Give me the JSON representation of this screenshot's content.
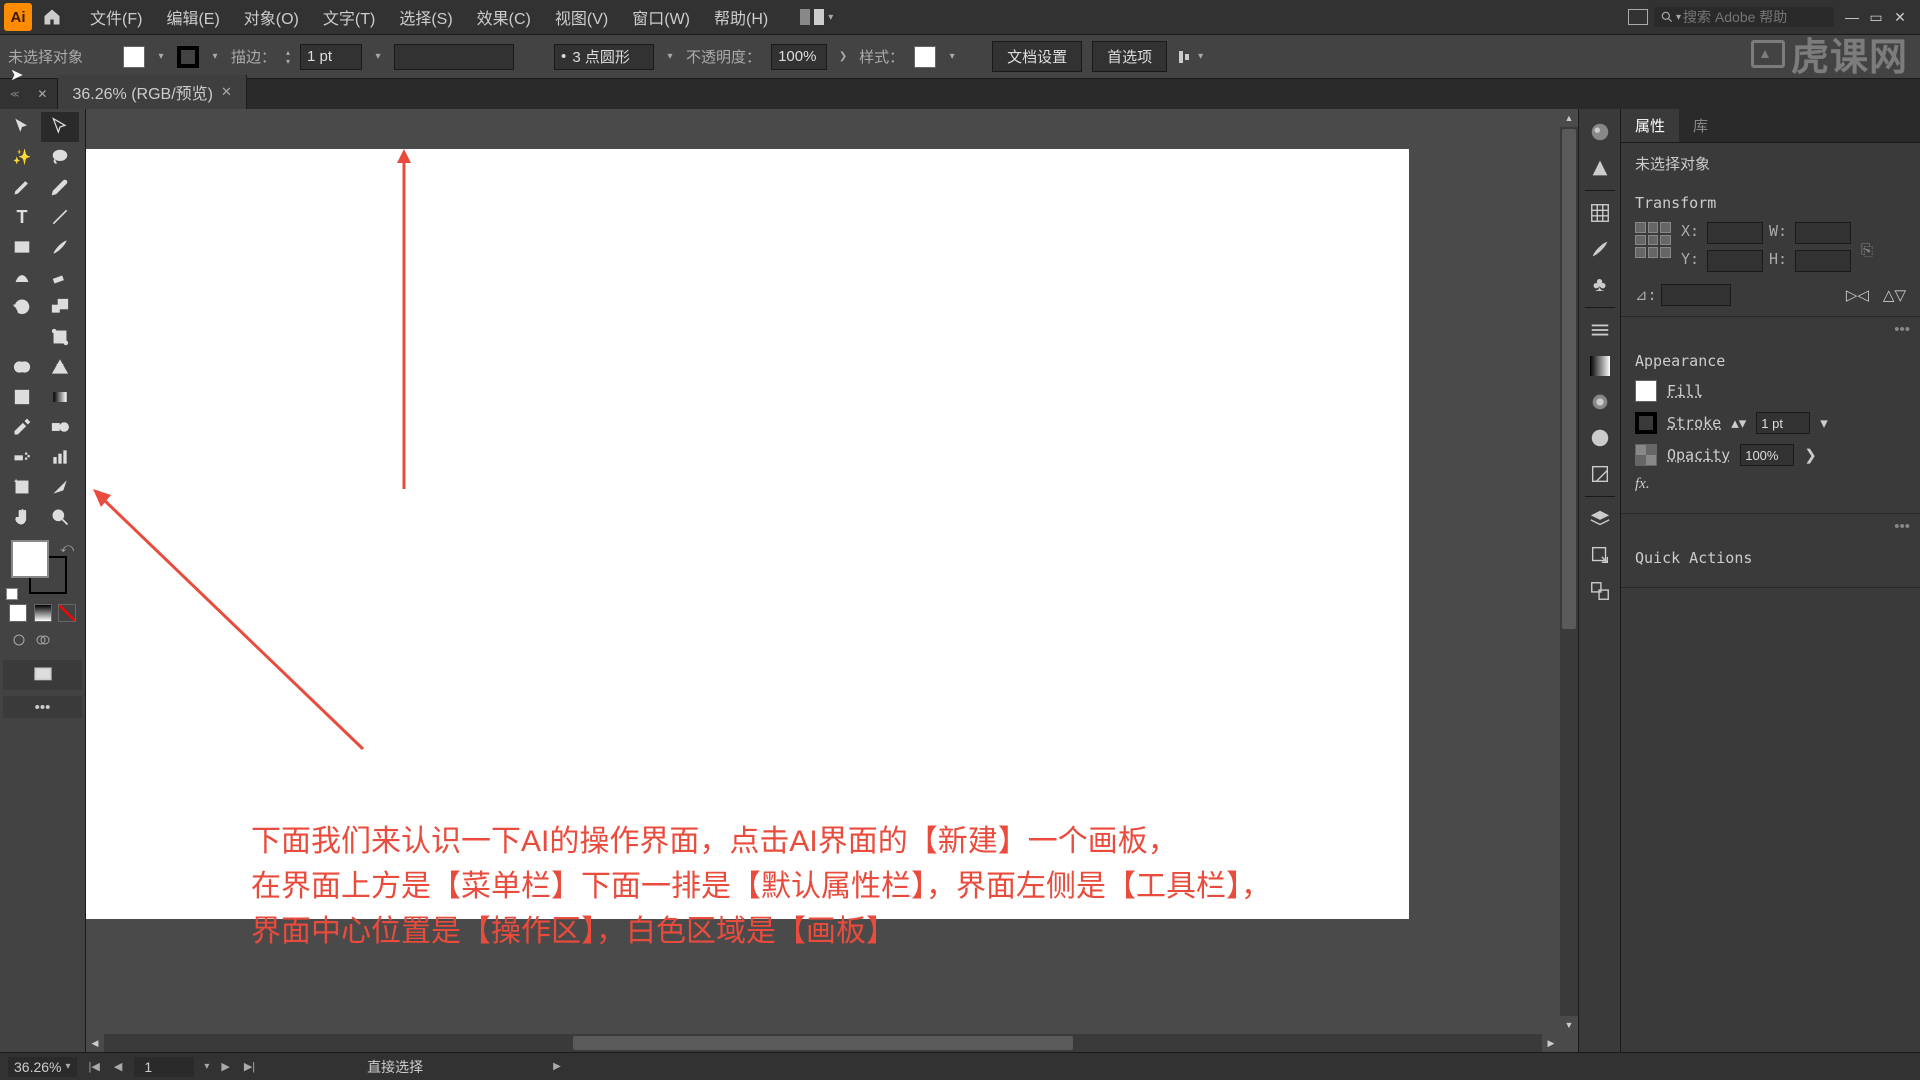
{
  "menubar": {
    "logo": "Ai",
    "items": [
      "文件(F)",
      "编辑(E)",
      "对象(O)",
      "文字(T)",
      "选择(S)",
      "效果(C)",
      "视图(V)",
      "窗口(W)",
      "帮助(H)"
    ],
    "search_placeholder": "搜索 Adobe 帮助"
  },
  "optionsbar": {
    "no_selection": "未选择对象",
    "stroke_label": "描边：",
    "stroke_value": "1 pt",
    "brush_label": "3 点圆形",
    "opacity_label": "不透明度：",
    "opacity_value": "100%",
    "style_label": "样式：",
    "doc_setup": "文档设置",
    "preferences": "首选项"
  },
  "tab": {
    "title": "36.26% (RGB/预览)"
  },
  "statusbar": {
    "zoom": "36.26%",
    "artboard": "1",
    "tool_hint": "直接选择"
  },
  "annotation": {
    "line1": "下面我们来认识一下AI的操作界面，点击AI界面的【新建】一个画板，",
    "line2": "在界面上方是【菜单栏】下面一排是【默认属性栏】，界面左侧是【工具栏】，",
    "line3": "界面中心位置是【操作区】，白色区域是【画板】"
  },
  "properties": {
    "tab_props": "属性",
    "tab_lib": "库",
    "no_selection": "未选择对象",
    "transform_title": "Transform",
    "x_label": "X:",
    "y_label": "Y:",
    "w_label": "W:",
    "h_label": "H:",
    "angle_label": "⊿:",
    "appearance_title": "Appearance",
    "fill_label": "Fill",
    "stroke_label": "Stroke",
    "stroke_value": "1 pt",
    "opacity_label": "Opacity",
    "opacity_value": "100%",
    "fx_label": "fx.",
    "quick_actions": "Quick Actions"
  },
  "watermark": "虎课网"
}
